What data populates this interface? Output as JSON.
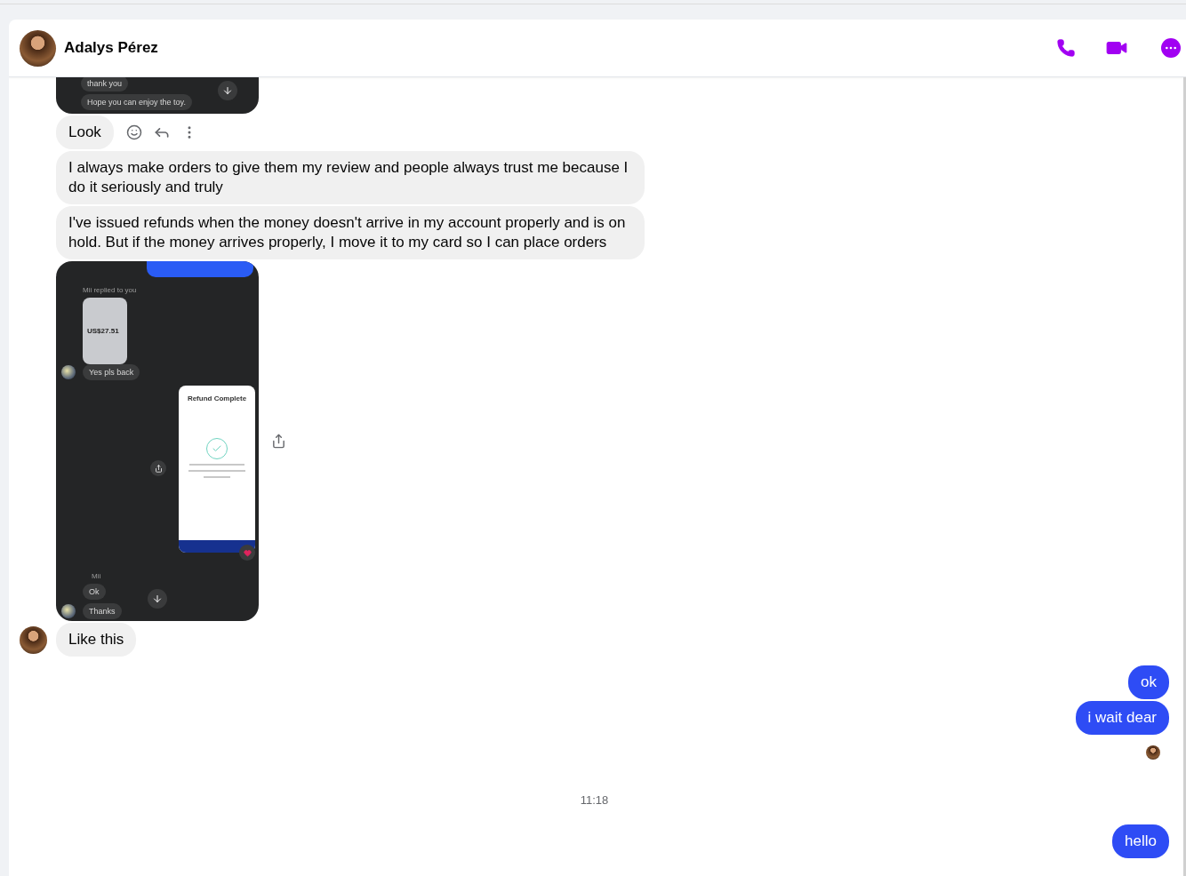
{
  "header": {
    "name": "Adalys Pérez"
  },
  "messages": [
    {
      "kind": "screenshot",
      "bubbles": [
        "thank you",
        "Hope you can enjoy the toy."
      ]
    },
    {
      "kind": "received",
      "text": "Look",
      "show_actions": true,
      "show_avatar": false
    },
    {
      "kind": "received",
      "text": "I always make orders to give them my review and people always trust me because I do it seriously and truly",
      "show_actions": false,
      "show_avatar": false
    },
    {
      "kind": "received",
      "text": "I've issued refunds when the money doesn't arrive in my account properly and is on hold. But if the money arrives properly, I move it to my card so I can place orders",
      "show_actions": false,
      "show_avatar": false
    },
    {
      "kind": "refund_screenshot",
      "reply_note": "Mii replied to you",
      "reply_amount": "US$27.51",
      "reply_text": "Yes pls back",
      "phone_title": "Refund Complete",
      "sender_name": "Mii",
      "bubbles": [
        "Ok",
        "Thanks"
      ]
    },
    {
      "kind": "received",
      "text": "Like this",
      "show_actions": false,
      "show_avatar": true
    },
    {
      "kind": "sent",
      "text": "ok"
    },
    {
      "kind": "sent",
      "text": "i wait dear"
    },
    {
      "kind": "seen"
    },
    {
      "kind": "timestamp",
      "text": "11:18"
    },
    {
      "kind": "sent",
      "text": "hello"
    }
  ]
}
